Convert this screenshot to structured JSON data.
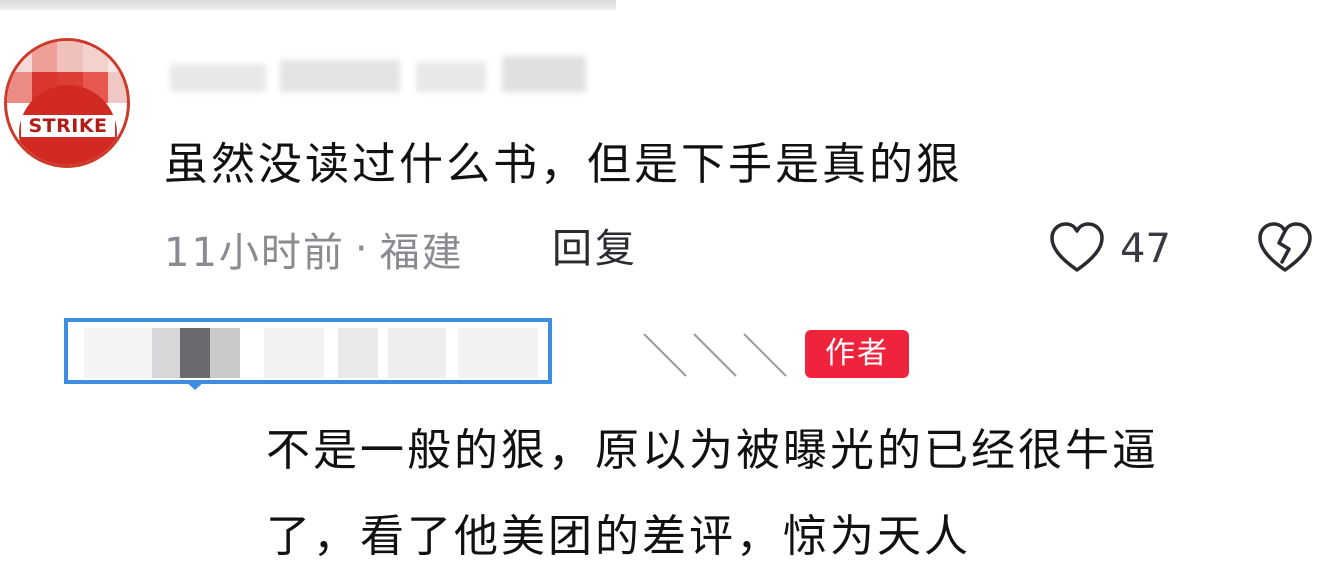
{
  "comments": [
    {
      "avatar_text": "STRIKE",
      "text": "虽然没读过什么书，但是下手是真的狠",
      "meta": {
        "time": "11小时前",
        "separator": "·",
        "location": "福建"
      },
      "reply_label": "回复",
      "like_count": "47",
      "icons": {
        "like": "heart-outline-icon",
        "dislike": "broken-heart-icon"
      }
    },
    {
      "author_badge": "作者",
      "text_lines": [
        "不是一般的狠，原以为被曝光的已经很牛逼",
        "了，看了他美团的差评，惊为天人"
      ]
    }
  ],
  "colors": {
    "author_badge_bg": "#f0233c",
    "highlight_border": "#3d8de0",
    "meta_text": "#8a8a90",
    "body_text": "#111111"
  }
}
